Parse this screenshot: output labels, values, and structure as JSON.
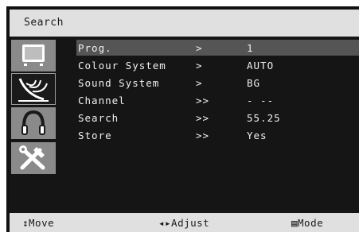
{
  "header": {
    "title": "Search"
  },
  "sidebar": {
    "icons": [
      "tv-picture-icon",
      "satellite-antenna-icon",
      "headphones-audio-icon",
      "tools-settings-icon"
    ],
    "selected_index": 1
  },
  "menu": {
    "rows": [
      {
        "label": "Prog.",
        "arrow": ">",
        "value": "1"
      },
      {
        "label": "Colour System",
        "arrow": ">",
        "value": "AUTO"
      },
      {
        "label": "Sound System",
        "arrow": ">",
        "value": "BG"
      },
      {
        "label": "Channel",
        "arrow": ">>",
        "value": "- --"
      },
      {
        "label": "Search",
        "arrow": ">>",
        "value": "55.25"
      },
      {
        "label": "Store",
        "arrow": ">>",
        "value": "Yes"
      }
    ],
    "highlighted_index": 0
  },
  "footer": {
    "move_hint": "↕Move",
    "adjust_hint": "◂▸Adjust",
    "mode_hint": "▤Mode"
  },
  "colors": {
    "background": "#111111",
    "bar": "#e0e0e0",
    "highlight": "#555555",
    "tile": "#8a8a8a",
    "text": "#f0f0f0"
  }
}
